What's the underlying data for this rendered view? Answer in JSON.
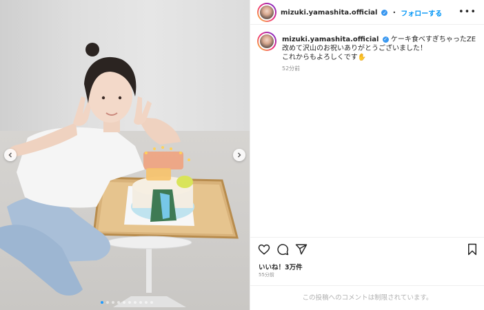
{
  "post": {
    "photo_alt": "",
    "carousel": {
      "total": 10,
      "active": 0
    }
  },
  "header": {
    "username": "mizuki.yamashita.official",
    "separator": "•",
    "follow_label": "フォローする",
    "more_label": "•••"
  },
  "caption": {
    "username": "mizuki.yamashita.official",
    "lines": [
      "ケーキ食べすぎちゃったZE",
      "改めて沢山のお祝いありがとうございました！",
      "これからもよろしくです✋"
    ],
    "time_ago": "52分前"
  },
  "engagement": {
    "likes": "いいね！3万件",
    "posted": "55分前"
  },
  "footer": {
    "comments_disabled": "この投稿へのコメントは制限されています。"
  },
  "icons": {
    "like": "heart-icon",
    "comment": "comment-icon",
    "share": "share-icon",
    "save": "bookmark-icon",
    "prev": "chevron-left-icon",
    "next": "chevron-right-icon",
    "verified": "verified-badge-icon"
  },
  "colors": {
    "accent": "#0095f6",
    "verified": "#3897f0",
    "muted": "#8e8e8e"
  }
}
